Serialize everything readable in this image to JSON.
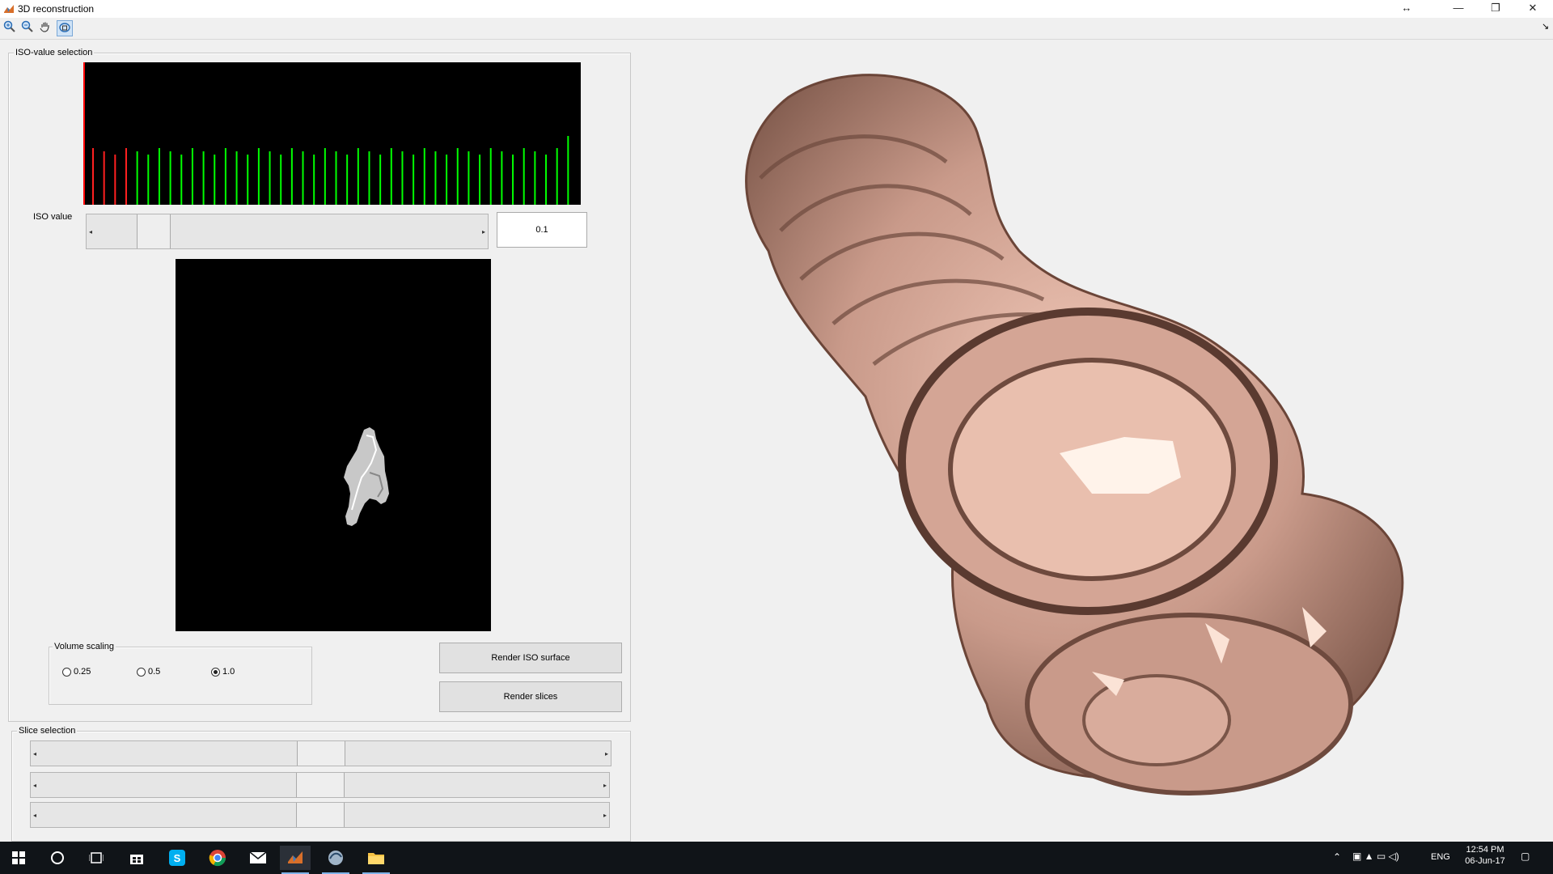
{
  "window": {
    "title": "3D reconstruction",
    "controls": [
      "↔",
      "—",
      "❐",
      "✕"
    ]
  },
  "toolbar": {
    "tools": [
      "zoom-in-icon",
      "zoom-out-icon",
      "pan-icon",
      "rotate-3d-icon"
    ],
    "dock_arrow": "↘"
  },
  "iso_panel": {
    "title": "ISO-value selection",
    "iso_label": "ISO value",
    "iso_value": "0.1",
    "iso_slider_level": 0.12,
    "histogram": {
      "threshold_color": "#ff0000",
      "below_color": "#ff2020",
      "above_color": "#00ff00",
      "bars_below": 4,
      "bars_above": 40
    },
    "volume_scaling": {
      "title": "Volume scaling",
      "options": [
        {
          "label": "0.25",
          "selected": false
        },
        {
          "label": "0.5",
          "selected": false
        },
        {
          "label": "1.0",
          "selected": true
        }
      ]
    },
    "render_iso_button": "Render ISO surface",
    "render_slices_button": "Render slices"
  },
  "slice_panel": {
    "title": "Slice selection",
    "sliders": [
      {
        "level": 0.5
      },
      {
        "level": 0.5
      },
      {
        "level": 0.5
      }
    ]
  },
  "colors": {
    "surface": "#c99a8a",
    "surface_shadow": "#7a5548",
    "surface_highlight": "#f3d2c2"
  },
  "taskbar": {
    "apps": [
      "windows-start-icon",
      "cortana-icon",
      "task-view-icon",
      "store-icon",
      "skype-icon",
      "chrome-icon",
      "mail-icon",
      "matlab-icon",
      "app-icon",
      "file-explorer-icon"
    ],
    "language": "ENG",
    "time": "12:54 PM",
    "date": "06-Jun-17"
  }
}
